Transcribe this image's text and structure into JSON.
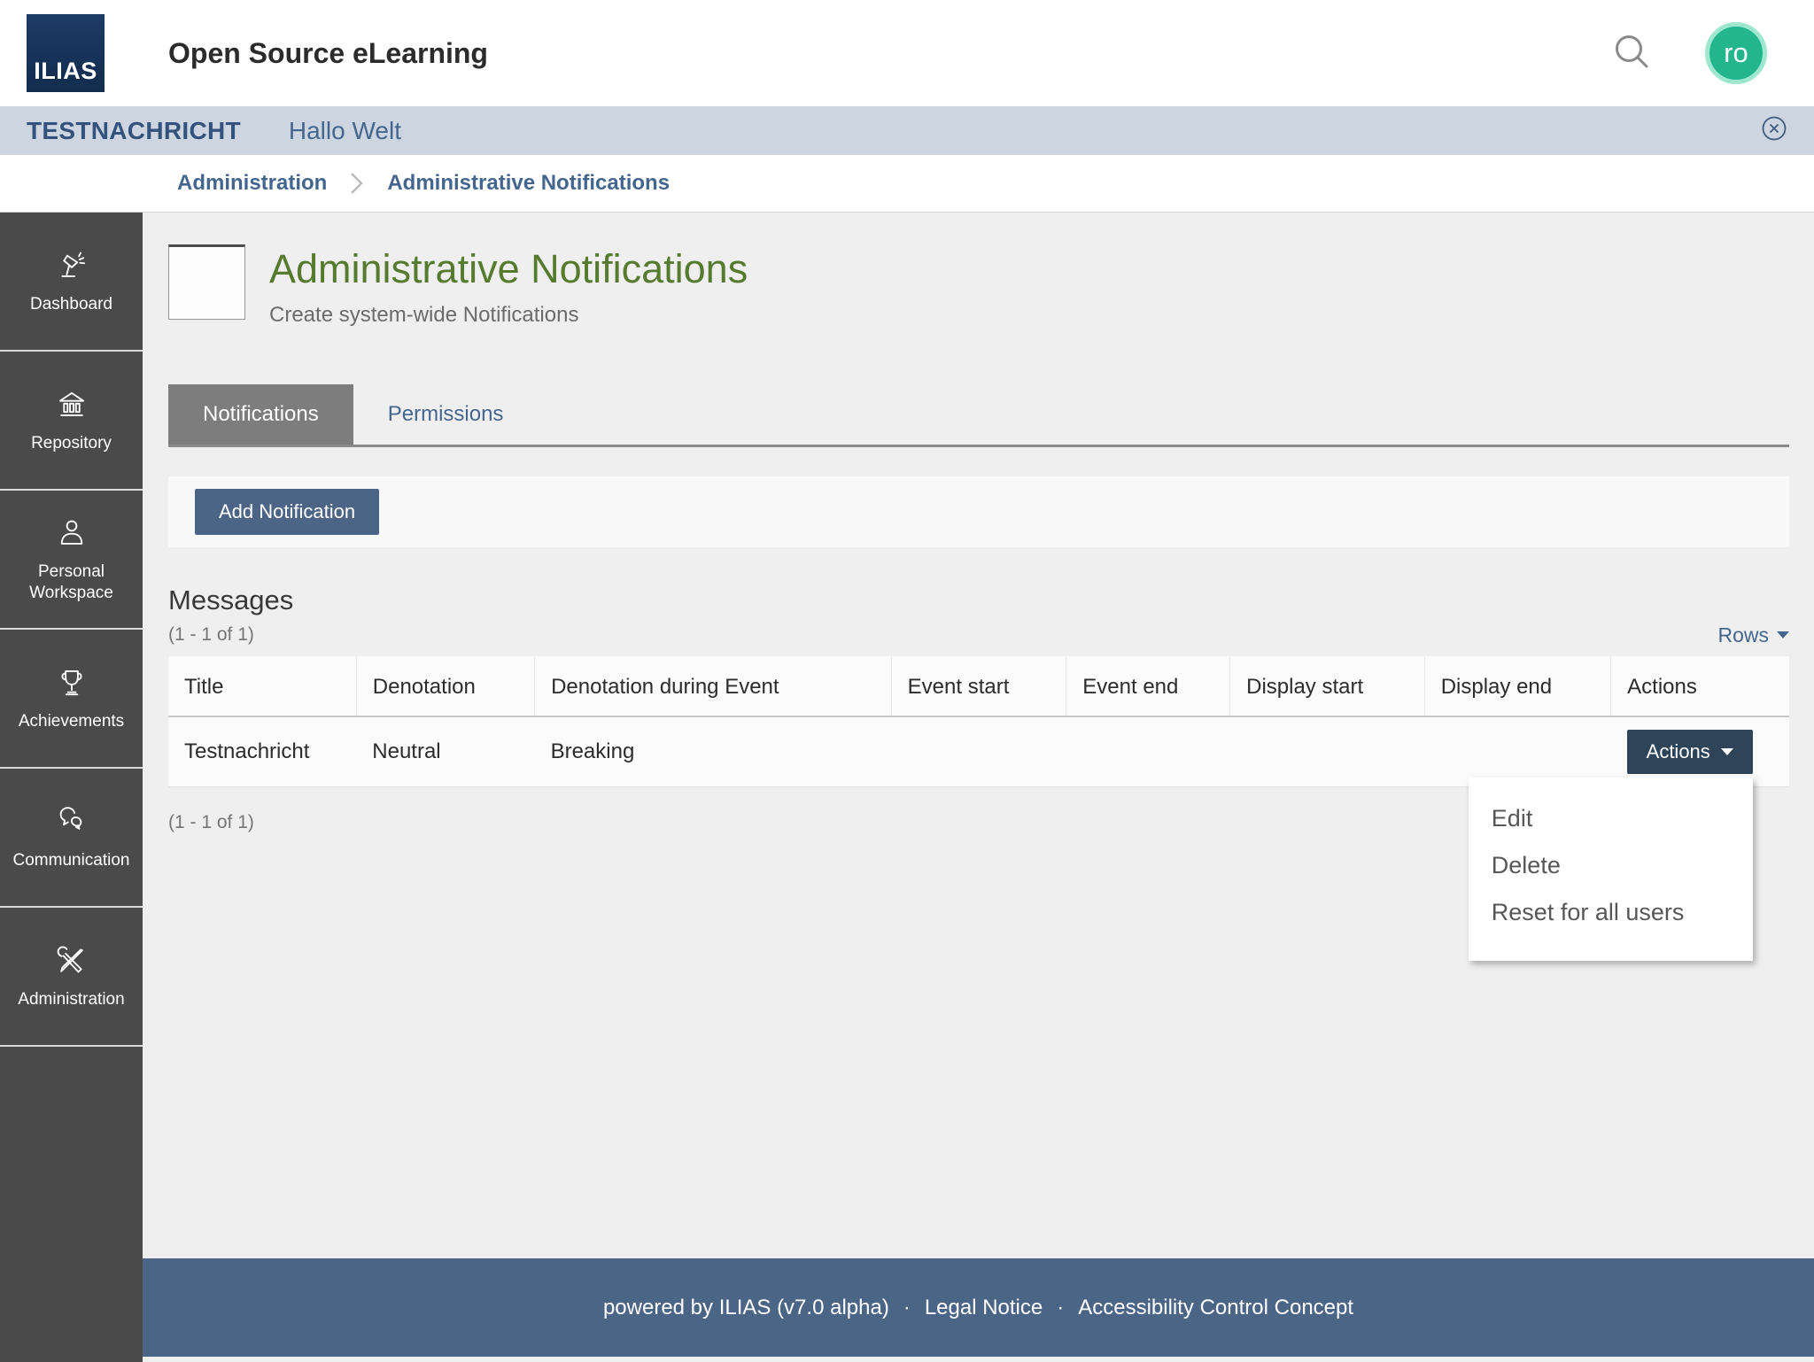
{
  "header": {
    "logo_text": "ILIAS",
    "brand": "Open Source eLearning",
    "avatar_text": "ro"
  },
  "notification_bar": {
    "title": "TESTNACHRICHT",
    "message": "Hallo Welt"
  },
  "breadcrumb": {
    "items": [
      "Administration",
      "Administrative Notifications"
    ]
  },
  "sidebar": {
    "items": [
      {
        "label": "Dashboard",
        "icon": "lamp-icon"
      },
      {
        "label": "Repository",
        "icon": "bank-icon"
      },
      {
        "label": "Personal Workspace",
        "icon": "person-icon"
      },
      {
        "label": "Achievements",
        "icon": "trophy-icon"
      },
      {
        "label": "Communication",
        "icon": "speech-bubbles-icon"
      },
      {
        "label": "Administration",
        "icon": "tools-icon"
      }
    ]
  },
  "page": {
    "title": "Administrative Notifications",
    "subtitle": "Create system-wide Notifications",
    "tabs": [
      {
        "label": "Notifications",
        "active": true
      },
      {
        "label": "Permissions",
        "active": false
      }
    ],
    "add_button": "Add Notification"
  },
  "messages": {
    "heading": "Messages",
    "count_top": "(1 - 1 of 1)",
    "count_bottom": "(1 - 1 of 1)",
    "rows_label": "Rows",
    "table": {
      "columns": [
        "Title",
        "Denotation",
        "Denotation during Event",
        "Event start",
        "Event end",
        "Display start",
        "Display end",
        "Actions"
      ],
      "rows": [
        {
          "title": "Testnachricht",
          "denotation": "Neutral",
          "denotation_during_event": "Breaking",
          "event_start": "",
          "event_end": "",
          "display_start": "",
          "display_end": "",
          "actions_label": "Actions"
        }
      ]
    },
    "actions_menu": {
      "items": [
        "Edit",
        "Delete",
        "Reset for all users"
      ]
    }
  },
  "footer": {
    "powered": "powered by ILIAS (v7.0 alpha)",
    "separator": "·",
    "links": [
      "Legal Notice",
      "Accessibility Control Concept"
    ]
  },
  "colors": {
    "sidebar_bg": "#4a4a4a",
    "content_bg": "#efefef",
    "footer_bg": "#4b6586",
    "accent_blue": "#4c6586",
    "dark_button": "#2e4459",
    "link_blue": "#44668e",
    "title_green": "#567b2f",
    "notification_bar_bg": "#cdd5e1",
    "avatar_bg": "#23b58c"
  }
}
